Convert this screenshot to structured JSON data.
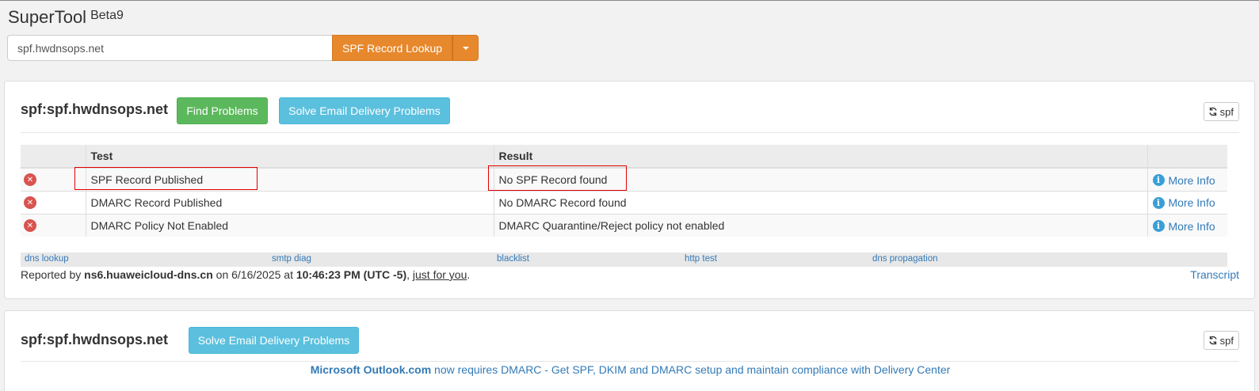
{
  "app": {
    "name": "SuperTool",
    "version": "Beta9"
  },
  "search": {
    "value": "spf.hwdnsops.net",
    "button_label": "SPF Record Lookup"
  },
  "panel1": {
    "title": "spf:spf.hwdnsops.net",
    "find_problems_label": "Find Problems",
    "solve_label": "Solve Email Delivery Problems",
    "refresh_label": "spf",
    "table": {
      "headers": [
        "",
        "Test",
        "Result",
        ""
      ],
      "rows": [
        {
          "status": "error",
          "test": "SPF Record Published",
          "result": "No SPF Record found",
          "more": "More Info"
        },
        {
          "status": "error",
          "test": "DMARC Record Published",
          "result": "No DMARC Record found",
          "more": "More Info"
        },
        {
          "status": "error",
          "test": "DMARC Policy Not Enabled",
          "result": "DMARC Quarantine/Reject policy not enabled",
          "more": "More Info"
        }
      ]
    },
    "links": [
      "dns lookup",
      "smtp diag",
      "blacklist",
      "http test",
      "dns propagation"
    ],
    "reported": {
      "prefix": "Reported by ",
      "server": "ns6.huaweicloud-dns.cn",
      "on": " on 6/16/2025 at ",
      "time": "10:46:23 PM (UTC -5)",
      "comma": ", ",
      "just": "just for you",
      "period": "."
    },
    "transcript_label": "Transcript"
  },
  "panel2": {
    "title": "spf:spf.hwdnsops.net",
    "solve_label": "Solve Email Delivery Problems",
    "refresh_label": "spf",
    "notice_bold": "Microsoft Outlook.com",
    "notice_text": " now requires DMARC - Get SPF, DKIM and DMARC setup and maintain compliance with Delivery Center"
  },
  "colors": {
    "orange": "#e8882c",
    "green": "#5cb85c",
    "blue": "#5bc0de",
    "error": "#d9534f",
    "link": "#337ab7",
    "highlight": "#e00000"
  }
}
